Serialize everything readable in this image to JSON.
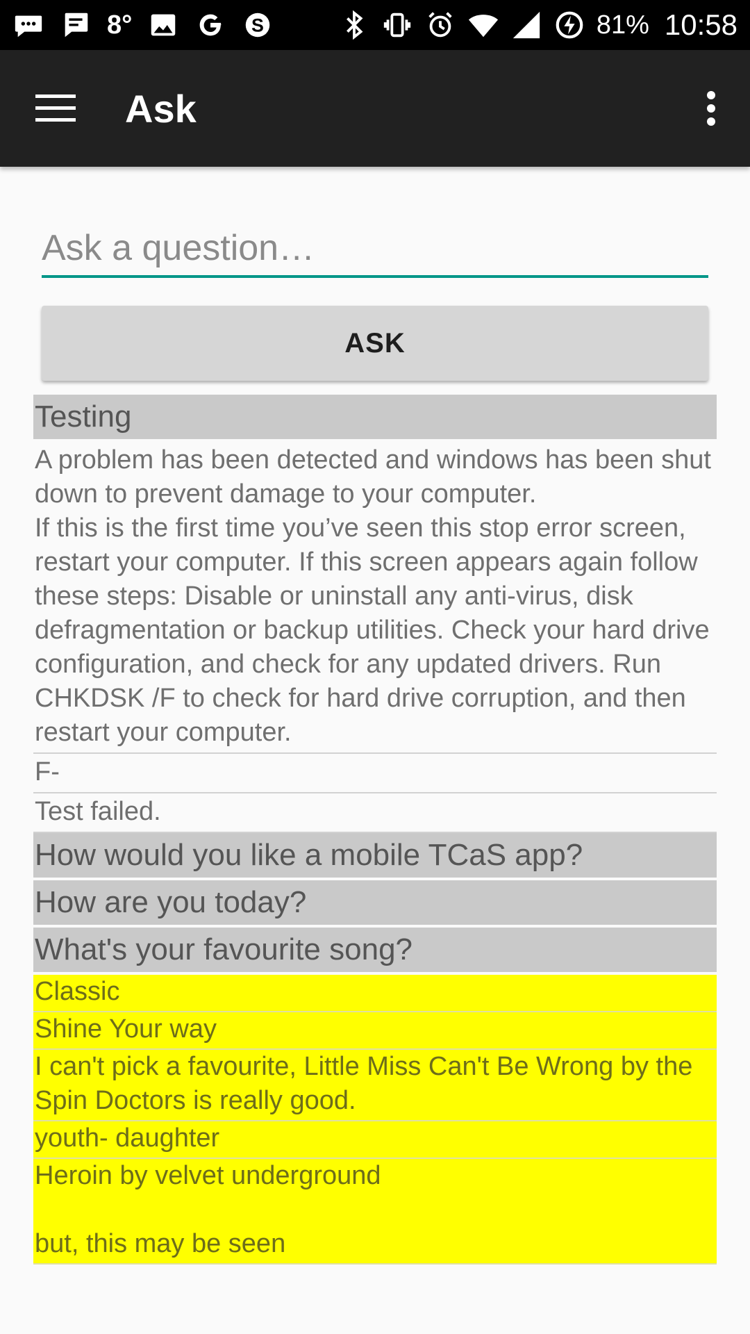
{
  "status_bar": {
    "temperature": "8°",
    "battery_percent": "81%",
    "time": "10:58",
    "left_icons": [
      "messenger-icon",
      "message-icon",
      "image-icon",
      "google-icon",
      "skype-icon"
    ],
    "right_icons": [
      "bluetooth-icon",
      "vibrate-icon",
      "alarm-icon",
      "wifi-icon",
      "signal-icon",
      "battery-charging-icon"
    ]
  },
  "app_bar": {
    "title": "Ask",
    "menu_icon": "hamburger-menu-icon",
    "overflow_icon": "more-vertical-icon",
    "background": "#212121"
  },
  "ask": {
    "placeholder": "Ask a question…",
    "value": "",
    "button_label": "ASK",
    "accent": "#009688"
  },
  "feed": {
    "items": [
      {
        "type": "question",
        "text": "Testing"
      },
      {
        "type": "answer",
        "style": "white",
        "paragraphs": [
          "A problem has been detected and windows has been shut down to prevent damage to your computer.",
          "If this is the first time you’ve seen this stop error screen, restart your computer. If this screen appears again follow these steps: Disable or uninstall any anti-virus, disk defragmentation or backup utilities. Check your hard drive configuration, and check for any updated drivers. Run CHKDSK /F to check for hard drive corruption, and then restart your computer."
        ]
      },
      {
        "type": "answer",
        "style": "white",
        "paragraphs": [
          "F-"
        ]
      },
      {
        "type": "answer",
        "style": "white",
        "paragraphs": [
          "Test failed."
        ]
      },
      {
        "type": "question",
        "text": "How would you like a mobile TCaS app?"
      },
      {
        "type": "question",
        "text": "How are you today?"
      },
      {
        "type": "question",
        "text": "What's your favourite song?"
      },
      {
        "type": "answer",
        "style": "yellow",
        "paragraphs": [
          "Classic"
        ]
      },
      {
        "type": "answer",
        "style": "yellow",
        "paragraphs": [
          "Shine Your way"
        ]
      },
      {
        "type": "answer",
        "style": "yellow",
        "paragraphs": [
          "I can't pick a favourite, Little Miss Can't Be Wrong by the Spin Doctors is really good."
        ]
      },
      {
        "type": "answer",
        "style": "yellow",
        "paragraphs": [
          "youth- daughter"
        ]
      },
      {
        "type": "answer",
        "style": "yellow",
        "paragraphs": [
          "Heroin by velvet underground",
          "",
          "but, this may be seen"
        ]
      }
    ],
    "question_bg": "#c9c9c9",
    "highlight_bg": "#ffff00"
  }
}
